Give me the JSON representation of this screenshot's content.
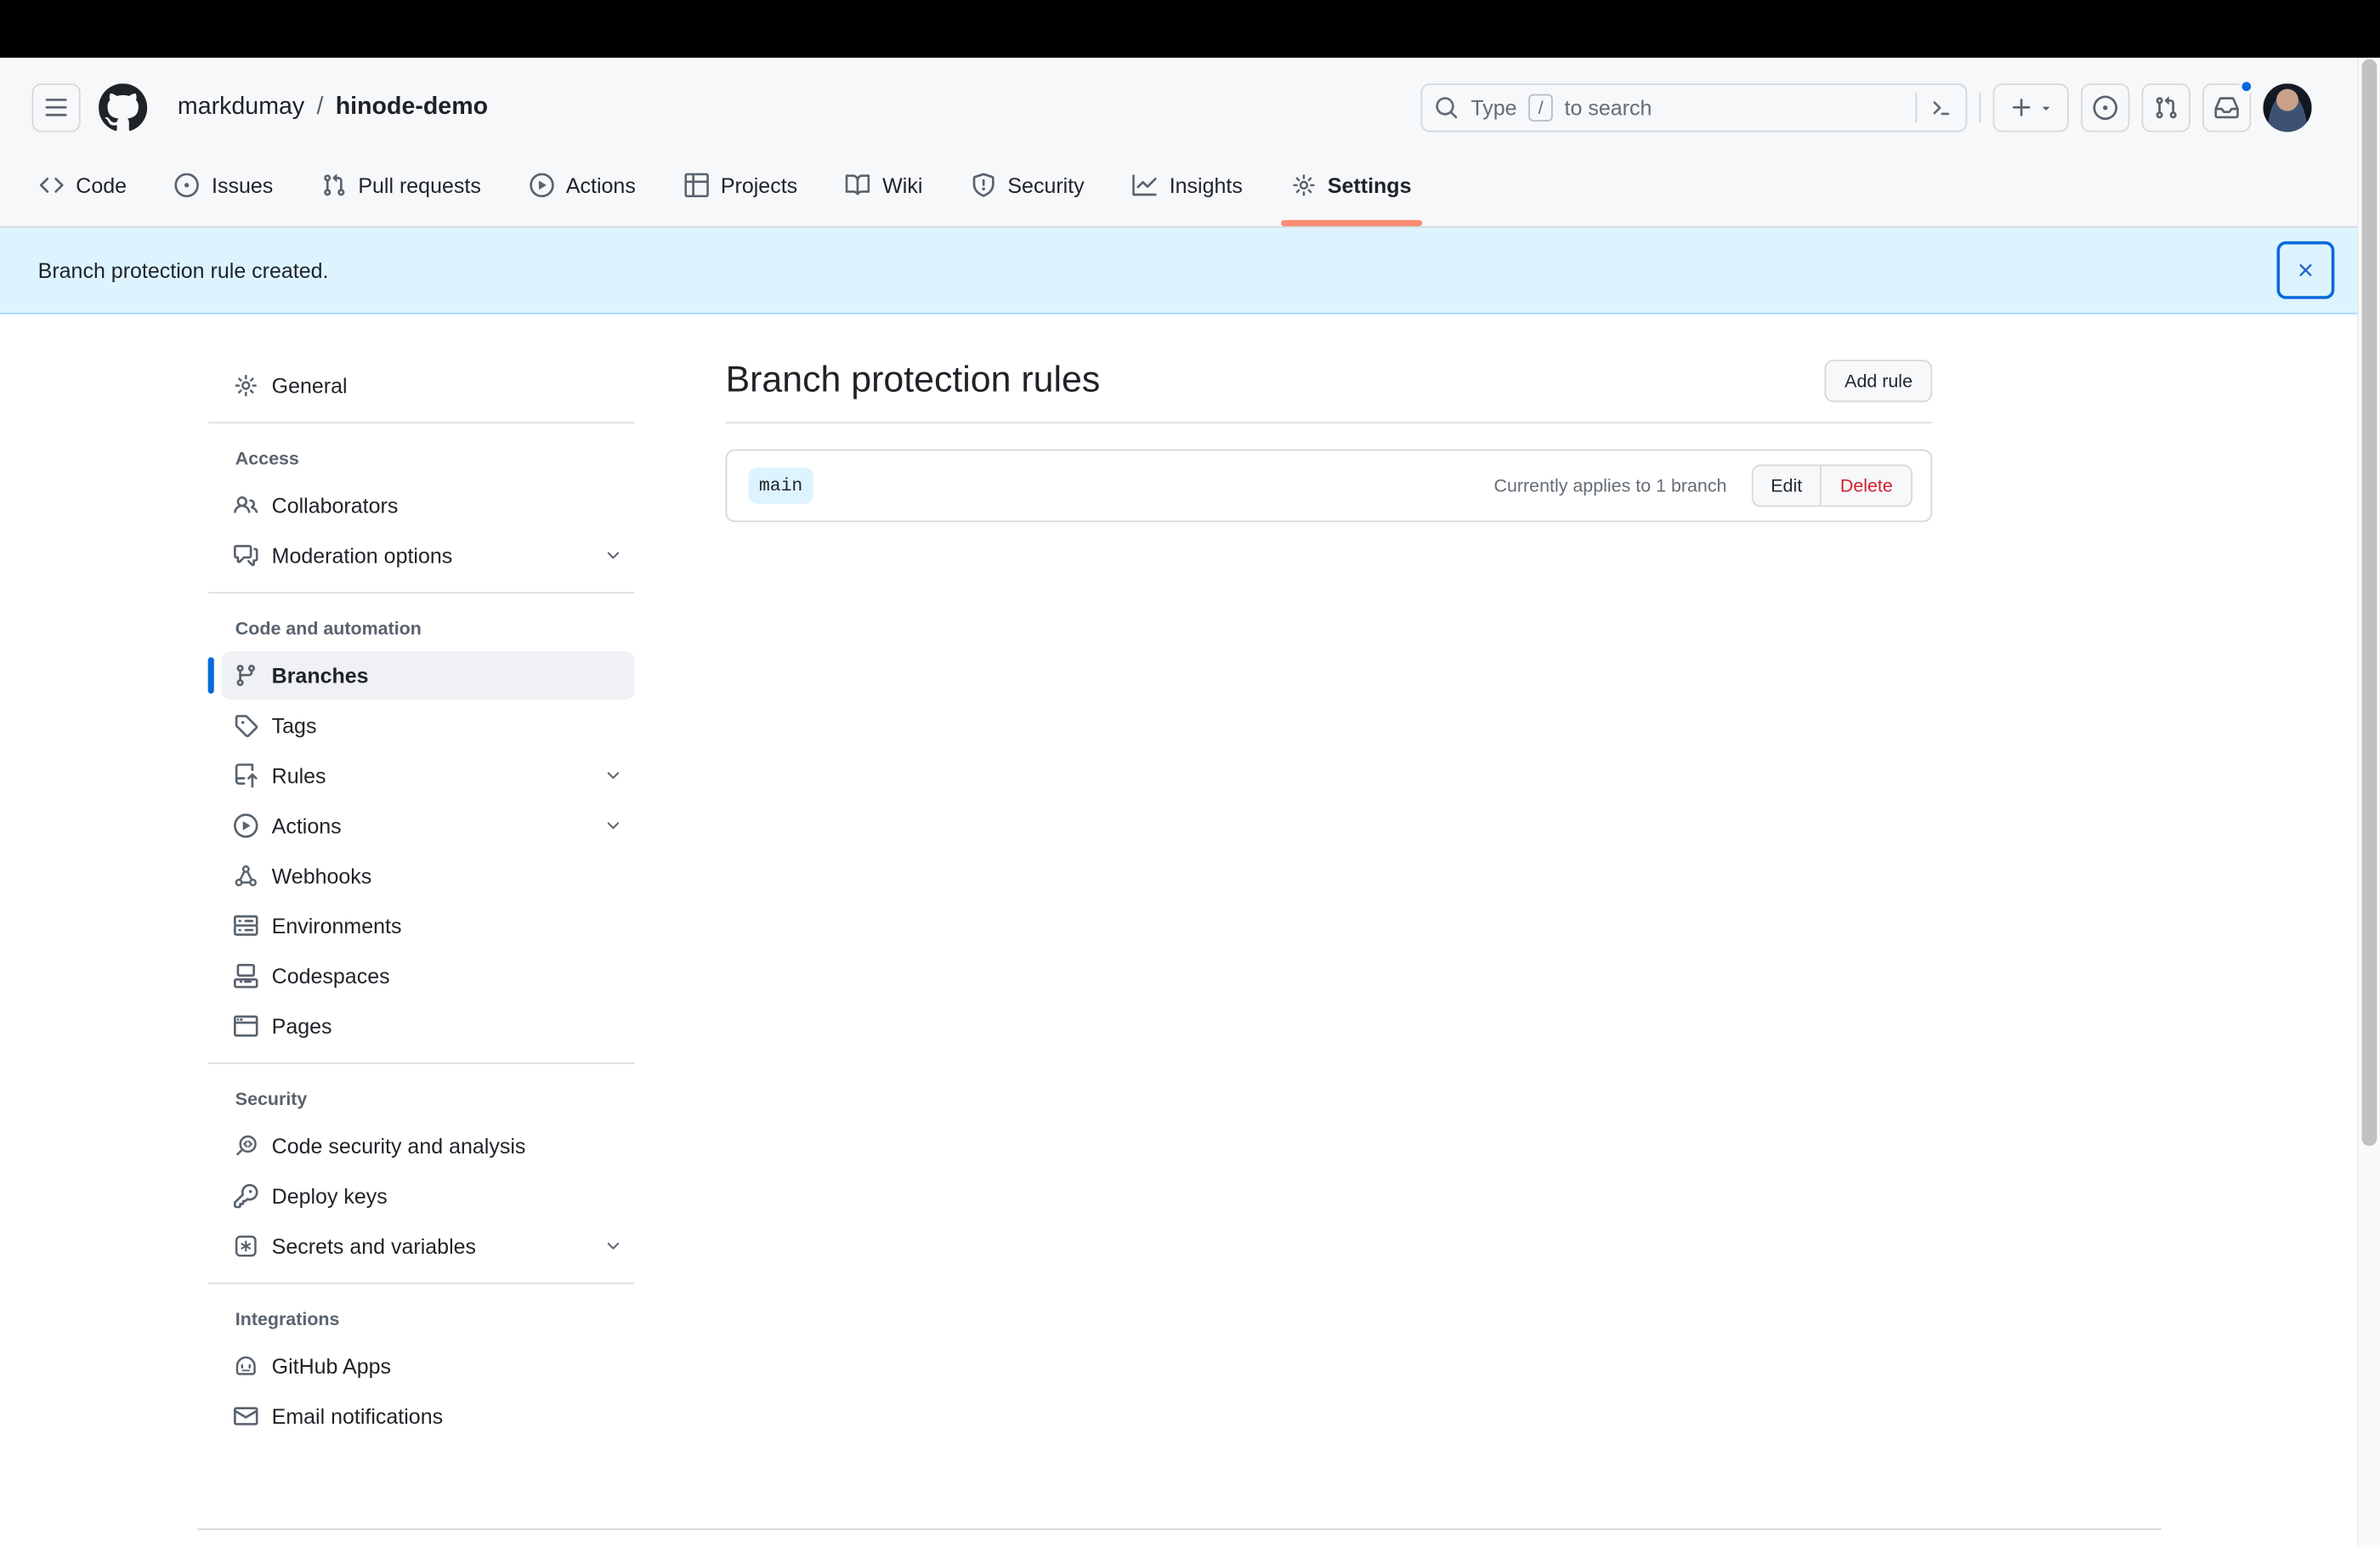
{
  "header": {
    "breadcrumb": {
      "owner": "markdumay",
      "separator": "/",
      "repo": "hinode-demo"
    },
    "search": {
      "placeholder_prefix": "Type",
      "key_hint": "/",
      "placeholder_suffix": "to search"
    },
    "icons": [
      "three-bars",
      "github-mark",
      "search",
      "command-palette",
      "plus",
      "triangle-down",
      "issue-opened",
      "git-pull-request",
      "inbox",
      "avatar"
    ],
    "notification_dot_color": "#0969da"
  },
  "nav": {
    "tabs": [
      {
        "label": "Code",
        "icon": "code-icon",
        "selected": false
      },
      {
        "label": "Issues",
        "icon": "issue-opened-icon",
        "selected": false
      },
      {
        "label": "Pull requests",
        "icon": "git-pull-request-icon",
        "selected": false
      },
      {
        "label": "Actions",
        "icon": "play-icon",
        "selected": false
      },
      {
        "label": "Projects",
        "icon": "project-icon",
        "selected": false
      },
      {
        "label": "Wiki",
        "icon": "book-icon",
        "selected": false
      },
      {
        "label": "Security",
        "icon": "shield-icon",
        "selected": false
      },
      {
        "label": "Insights",
        "icon": "graph-icon",
        "selected": false
      },
      {
        "label": "Settings",
        "icon": "gear-icon",
        "selected": true
      }
    ],
    "selected_underline_color": "#fd8c73"
  },
  "banner": {
    "message": "Branch protection rule created.",
    "background": "#ddf4ff",
    "close_icon": "x-icon"
  },
  "sidebar": {
    "general_label": "General",
    "sections": [
      {
        "title": "Access",
        "items": [
          {
            "label": "Collaborators",
            "icon": "people-icon",
            "expandable": false,
            "selected": false
          },
          {
            "label": "Moderation options",
            "icon": "comment-discussion-icon",
            "expandable": true,
            "selected": false
          }
        ]
      },
      {
        "title": "Code and automation",
        "items": [
          {
            "label": "Branches",
            "icon": "git-branch-icon",
            "expandable": false,
            "selected": true
          },
          {
            "label": "Tags",
            "icon": "tag-icon",
            "expandable": false,
            "selected": false
          },
          {
            "label": "Rules",
            "icon": "repo-push-icon",
            "expandable": true,
            "selected": false
          },
          {
            "label": "Actions",
            "icon": "play-icon",
            "expandable": true,
            "selected": false
          },
          {
            "label": "Webhooks",
            "icon": "webhook-icon",
            "expandable": false,
            "selected": false
          },
          {
            "label": "Environments",
            "icon": "server-icon",
            "expandable": false,
            "selected": false
          },
          {
            "label": "Codespaces",
            "icon": "codespaces-icon",
            "expandable": false,
            "selected": false
          },
          {
            "label": "Pages",
            "icon": "browser-icon",
            "expandable": false,
            "selected": false
          }
        ]
      },
      {
        "title": "Security",
        "items": [
          {
            "label": "Code security and analysis",
            "icon": "codescan-icon",
            "expandable": false,
            "selected": false
          },
          {
            "label": "Deploy keys",
            "icon": "key-icon",
            "expandable": false,
            "selected": false
          },
          {
            "label": "Secrets and variables",
            "icon": "asterisk-box-icon",
            "expandable": true,
            "selected": false
          }
        ]
      },
      {
        "title": "Integrations",
        "items": [
          {
            "label": "GitHub Apps",
            "icon": "hubot-icon",
            "expandable": false,
            "selected": false
          },
          {
            "label": "Email notifications",
            "icon": "mail-icon",
            "expandable": false,
            "selected": false
          }
        ]
      }
    ],
    "selected_accent_color": "#0969da"
  },
  "main": {
    "title": "Branch protection rules",
    "add_rule_label": "Add rule",
    "rules": [
      {
        "branch": "main",
        "status": "Currently applies to 1 branch",
        "edit_label": "Edit",
        "delete_label": "Delete",
        "delete_color": "#cf222e"
      }
    ]
  }
}
